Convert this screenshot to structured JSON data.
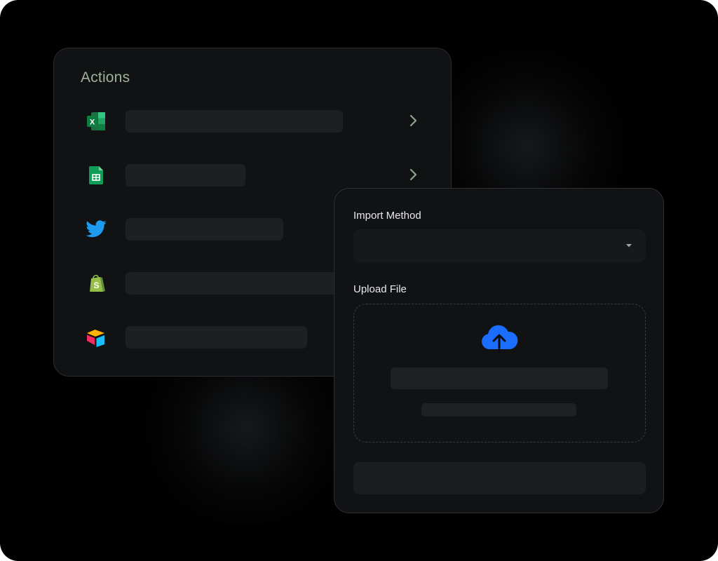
{
  "actions": {
    "title": "Actions",
    "items": [
      {
        "icon": "excel-icon",
        "has_chevron": true
      },
      {
        "icon": "google-sheets-icon",
        "has_chevron": true
      },
      {
        "icon": "twitter-icon",
        "has_chevron": false
      },
      {
        "icon": "shopify-icon",
        "has_chevron": false
      },
      {
        "icon": "airtable-icon",
        "has_chevron": false
      }
    ]
  },
  "import": {
    "method_label": "Import Method",
    "upload_label": "Upload File",
    "upload_icon": "cloud-upload-icon"
  },
  "colors": {
    "background": "#000000",
    "panel": "#111214",
    "title_accent": "#9fb29a",
    "upload_accent": "#1a6dff",
    "placeholder": "#1e1f22"
  }
}
